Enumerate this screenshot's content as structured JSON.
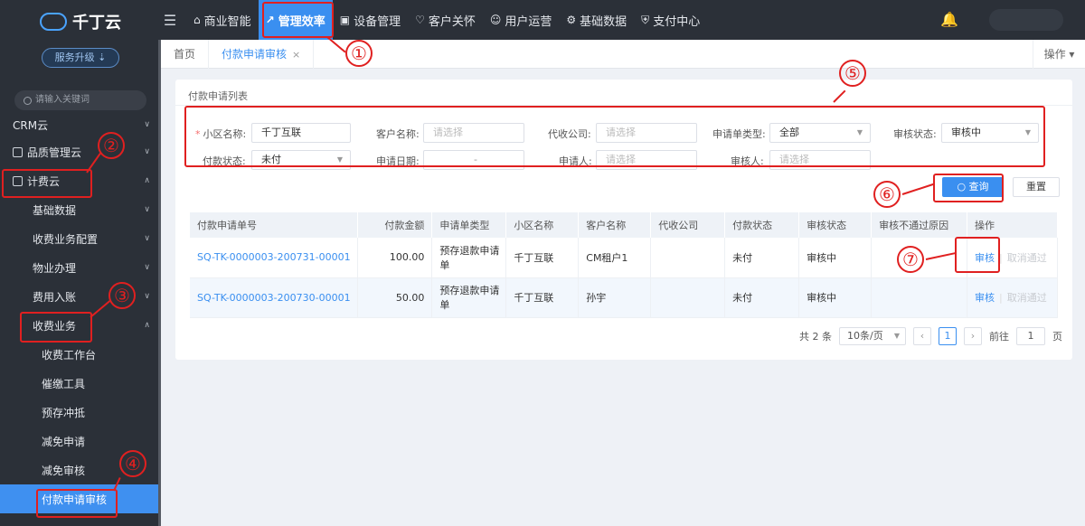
{
  "app": {
    "logo_text": "千丁云",
    "upgrade_label": "服务升级",
    "search_placeholder": "请输入关键词"
  },
  "sidebar": {
    "items": [
      {
        "label": "CRM云",
        "level": 0,
        "chevron": "∨"
      },
      {
        "label": "品质管理云",
        "level": 0,
        "chevron": "∨"
      },
      {
        "label": "计费云",
        "level": 0,
        "chevron": "∧"
      },
      {
        "label": "基础数据",
        "level": 1,
        "chevron": "∨"
      },
      {
        "label": "收费业务配置",
        "level": 1,
        "chevron": "∨"
      },
      {
        "label": "物业办理",
        "level": 1,
        "chevron": "∨"
      },
      {
        "label": "费用入账",
        "level": 1,
        "chevron": "∨"
      },
      {
        "label": "收费业务",
        "level": 1,
        "chevron": "∧"
      },
      {
        "label": "收费工作台",
        "level": 2
      },
      {
        "label": "催缴工具",
        "level": 2
      },
      {
        "label": "预存冲抵",
        "level": 2
      },
      {
        "label": "减免申请",
        "level": 2
      },
      {
        "label": "减免审核",
        "level": 2
      },
      {
        "label": "付款申请审核",
        "level": 2,
        "active": true
      }
    ]
  },
  "topnav": {
    "items": [
      {
        "label": "商业智能",
        "icon": "chart-bar-icon",
        "glyph": "⌂"
      },
      {
        "label": "管理效率",
        "icon": "trend-icon",
        "glyph": "↗",
        "active": true
      },
      {
        "label": "设备管理",
        "icon": "device-icon",
        "glyph": "▣"
      },
      {
        "label": "客户关怀",
        "icon": "heart-icon",
        "glyph": "♡"
      },
      {
        "label": "用户运营",
        "icon": "user-icon",
        "glyph": "☺"
      },
      {
        "label": "基础数据",
        "icon": "wrench-icon",
        "glyph": "⚙"
      },
      {
        "label": "支付中心",
        "icon": "shield-icon",
        "glyph": "⛨"
      }
    ]
  },
  "tabs": {
    "home": "首页",
    "current": "付款申请审核",
    "close": "×",
    "ops": "操作"
  },
  "form": {
    "title": "付款申请列表",
    "fields": {
      "community": {
        "label": "小区名称:",
        "value": "千丁互联",
        "required": "*"
      },
      "customer": {
        "label": "客户名称:",
        "placeholder": "请选择"
      },
      "collector": {
        "label": "代收公司:",
        "placeholder": "请选择"
      },
      "request_type": {
        "label": "申请单类型:",
        "value": "全部"
      },
      "review_status": {
        "label": "审核状态:",
        "value": "审核中"
      },
      "pay_status": {
        "label": "付款状态:",
        "value": "未付"
      },
      "apply_date": {
        "label": "申请日期:",
        "sep": "-"
      },
      "applicant": {
        "label": "申请人:",
        "placeholder": "请选择"
      },
      "reviewer": {
        "label": "审核人:",
        "placeholder": "请选择"
      }
    },
    "query_label": "查询",
    "reset_label": "重置"
  },
  "table": {
    "headers": [
      "付款申请单号",
      "付款金额",
      "申请单类型",
      "小区名称",
      "客户名称",
      "代收公司",
      "付款状态",
      "审核状态",
      "审核不通过原因",
      "操作"
    ],
    "rows": [
      {
        "id": "SQ-TK-0000003-200731-00001",
        "amount": "100.00",
        "type": "预存退款申请单",
        "community": "千丁互联",
        "customer": "CM租户1",
        "collector": "",
        "pay_status": "未付",
        "review_status": "审核中",
        "reason": "",
        "action1": "审核",
        "action2": "取消通过"
      },
      {
        "id": "SQ-TK-0000003-200730-00001",
        "amount": "50.00",
        "type": "预存退款申请单",
        "community": "千丁互联",
        "customer": "孙宇",
        "collector": "",
        "pay_status": "未付",
        "review_status": "审核中",
        "reason": "",
        "action1": "审核",
        "action2": "取消通过"
      }
    ]
  },
  "pager": {
    "total": "共 2 条",
    "page_size": "10条/页",
    "current": "1",
    "goto_label": "前往",
    "goto_value": "1",
    "page_unit": "页"
  },
  "annotations": [
    "①",
    "②",
    "③",
    "④",
    "⑤",
    "⑥",
    "⑦"
  ],
  "colors": {
    "accent": "#3a8ff0",
    "sidebar_bg": "#2b3038",
    "annotation": "#e02020"
  }
}
